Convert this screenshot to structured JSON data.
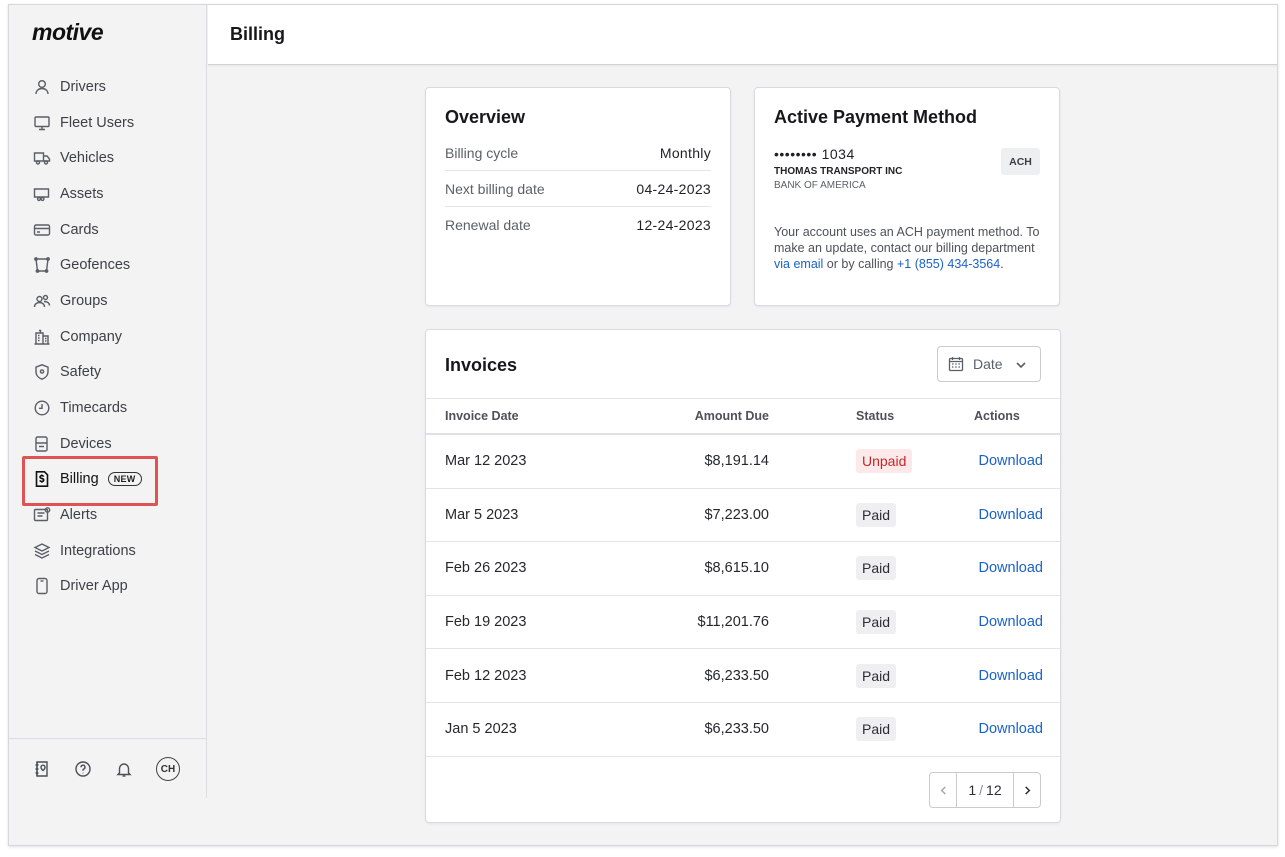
{
  "app": {
    "logo": "motive"
  },
  "sidebar": {
    "items": [
      {
        "label": "Drivers",
        "icon": "user-icon"
      },
      {
        "label": "Fleet Users",
        "icon": "monitor-icon"
      },
      {
        "label": "Vehicles",
        "icon": "truck-icon"
      },
      {
        "label": "Assets",
        "icon": "trailer-icon"
      },
      {
        "label": "Cards",
        "icon": "card-icon"
      },
      {
        "label": "Geofences",
        "icon": "geofence-icon"
      },
      {
        "label": "Groups",
        "icon": "group-icon"
      },
      {
        "label": "Company",
        "icon": "building-icon"
      },
      {
        "label": "Safety",
        "icon": "shield-icon"
      },
      {
        "label": "Timecards",
        "icon": "clock-icon"
      },
      {
        "label": "Devices",
        "icon": "device-icon"
      },
      {
        "label": "Billing",
        "icon": "billing-icon",
        "badge": "NEW",
        "active": true
      },
      {
        "label": "Alerts",
        "icon": "alert-icon"
      },
      {
        "label": "Integrations",
        "icon": "layers-icon"
      },
      {
        "label": "Driver App",
        "icon": "phone-icon"
      }
    ],
    "footer": {
      "avatar_initials": "CH"
    }
  },
  "header": {
    "title": "Billing"
  },
  "overview": {
    "title": "Overview",
    "rows": [
      {
        "label": "Billing cycle",
        "value": "Monthly"
      },
      {
        "label": "Next billing date",
        "value": "04-24-2023"
      },
      {
        "label": "Renewal date",
        "value": "12-24-2023"
      }
    ]
  },
  "payment": {
    "title": "Active Payment Method",
    "account_number": "•••••••• 1034",
    "account_name": "THOMAS TRANSPORT INC",
    "bank": "BANK OF AMERICA",
    "method_badge": "ACH",
    "note_prefix": "Your account uses an ACH payment method. To make an update, contact our billing department ",
    "note_email_link": "via email",
    "note_middle": " or by calling ",
    "note_phone_link": "+1 (855) 434-3564",
    "note_suffix": "."
  },
  "invoices": {
    "title": "Invoices",
    "filter_label": "Date",
    "columns": [
      "Invoice Date",
      "Amount Due",
      "Status",
      "Actions"
    ],
    "rows": [
      {
        "date": "Mar 12 2023",
        "amount": "$8,191.14",
        "status": "Unpaid",
        "action": "Download"
      },
      {
        "date": "Mar 5 2023",
        "amount": "$7,223.00",
        "status": "Paid",
        "action": "Download"
      },
      {
        "date": "Feb 26 2023",
        "amount": "$8,615.10",
        "status": "Paid",
        "action": "Download"
      },
      {
        "date": "Feb 19 2023",
        "amount": "$11,201.76",
        "status": "Paid",
        "action": "Download"
      },
      {
        "date": "Feb 12 2023",
        "amount": "$6,233.50",
        "status": "Paid",
        "action": "Download"
      },
      {
        "date": "Jan 5 2023",
        "amount": "$6,233.50",
        "status": "Paid",
        "action": "Download"
      }
    ],
    "pagination": {
      "current": "1",
      "total": "12"
    }
  },
  "colors": {
    "link": "#1a62c9",
    "unpaid_text": "#c62828",
    "unpaid_bg": "#fde9e9",
    "highlight_border": "#e05353"
  }
}
